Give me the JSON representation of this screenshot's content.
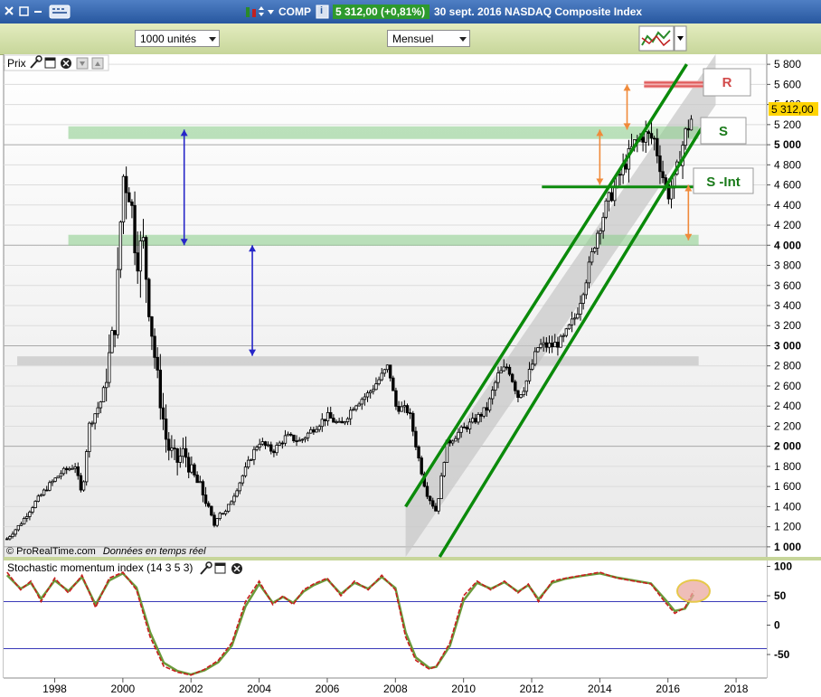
{
  "window": {
    "ticker": "COMP",
    "info_icon": "i",
    "price_badge": "5 312,00 (+0,81%)",
    "caption": "30 sept. 2016 NASDAQ Composite Index"
  },
  "toolbar": {
    "units": "1000 unités",
    "period": "Mensuel"
  },
  "panels": {
    "price": {
      "label": "Prix",
      "last_price": "5 312,00",
      "credit": "© ProRealTime.com",
      "credit_note": "Données en temps réel"
    },
    "stochastic": {
      "label": "Stochastic momentum index (14 3 5 3)"
    }
  },
  "annotations": {
    "resistance": "R",
    "support": "S",
    "support_int": "S -Int"
  },
  "colors": {
    "resistance": "#e05a5a",
    "support_band": "#8fce8f",
    "channel": "#0a8a0a",
    "arrow_blue": "#2626c8",
    "arrow_orange": "#f08a3a",
    "candles": "#000000",
    "smi": "#c81e1e",
    "signal": "#6a9a3a",
    "titlebar": "#3a6ab0"
  },
  "chart_data": [
    {
      "type": "line",
      "x_tick_labels": [
        "1998",
        "2000",
        "2002",
        "2004",
        "2006",
        "2008",
        "2010",
        "2012",
        "2014",
        "2016",
        "2018"
      ],
      "y_tick_labels": [
        "1 000",
        "1 200",
        "1 400",
        "1 600",
        "1 800",
        "2 000",
        "2 200",
        "2 400",
        "2 600",
        "2 800",
        "3 000",
        "3 200",
        "3 400",
        "3 600",
        "3 800",
        "4 000",
        "4 200",
        "4 400",
        "4 600",
        "4 800",
        "5 000",
        "5 200",
        "5 400",
        "5 600",
        "5 800"
      ],
      "bold_ticks": [
        "1 000",
        "2 000",
        "3 000",
        "4 000",
        "5 000"
      ],
      "ylim": [
        900,
        5900
      ],
      "xlim": [
        1996.5,
        2018.9
      ],
      "series": [
        {
          "x": [
            1996.6,
            1997.0,
            1997.4,
            1997.8,
            1998.2,
            1998.6,
            1998.8,
            1999.0,
            1999.4,
            1999.8,
            2000.0,
            2000.2,
            2000.4,
            2000.6,
            2000.8,
            2001.0,
            2001.3,
            2001.6,
            2001.8,
            2002.0,
            2002.4,
            2002.7,
            2002.8,
            2003.0,
            2003.4,
            2003.8,
            2004.0,
            2004.4,
            2004.8,
            2005.2,
            2005.6,
            2006.0,
            2006.4,
            2006.8,
            2007.2,
            2007.6,
            2007.8,
            2008.0,
            2008.4,
            2008.7,
            2008.9,
            2009.2,
            2009.5,
            2009.9,
            2010.3,
            2010.7,
            2011.0,
            2011.3,
            2011.6,
            2011.8,
            2012.2,
            2012.6,
            2012.9,
            2013.3,
            2013.7,
            2013.9,
            2014.2,
            2014.6,
            2015.0,
            2015.3,
            2015.6,
            2015.8,
            2016.0,
            2016.2,
            2016.5,
            2016.75
          ],
          "values": [
            1080,
            1230,
            1430,
            1600,
            1740,
            1810,
            1500,
            2200,
            2480,
            3300,
            4700,
            4570,
            3900,
            4000,
            3300,
            2700,
            2000,
            1850,
            1950,
            1750,
            1500,
            1200,
            1350,
            1330,
            1620,
            1920,
            2050,
            1950,
            2100,
            2050,
            2180,
            2300,
            2200,
            2420,
            2520,
            2700,
            2800,
            2400,
            2350,
            1850,
            1550,
            1350,
            2020,
            2150,
            2250,
            2380,
            2700,
            2800,
            2500,
            2600,
            3000,
            3000,
            3050,
            3300,
            3800,
            4100,
            4400,
            4700,
            5000,
            5100,
            5050,
            4750,
            4500,
            4650,
            5100,
            5312
          ]
        }
      ],
      "resistance_level": 5600,
      "support_levels": [
        5120,
        4050
      ],
      "support_int_level": 4580,
      "gray_band_level": 2850,
      "channel_lower": {
        "x": [
          2009.3,
          2017.05
        ],
        "y": [
          900,
          5200
        ]
      },
      "channel_upper": {
        "x": [
          2008.3,
          2016.55
        ],
        "y": [
          1400,
          5800
        ]
      },
      "blue_arrows": [
        {
          "x": 2001.8,
          "from": 5150,
          "to": 4000
        },
        {
          "x": 2003.8,
          "from": 4000,
          "to": 2900
        }
      ],
      "orange_arrows": [
        {
          "x": 2014.0,
          "from": 4600,
          "to": 5150
        },
        {
          "x": 2014.8,
          "from": 5150,
          "to": 5600
        },
        {
          "x": 2016.6,
          "from": 4600,
          "to": 4050
        }
      ]
    },
    {
      "type": "line",
      "y_tick_labels": [
        "100",
        "50",
        "0",
        "-50"
      ],
      "ylim": [
        -90,
        110
      ],
      "reference_lines": [
        40,
        -40
      ],
      "series": [
        {
          "x": [
            1996.6,
            1997.0,
            1997.3,
            1997.6,
            1998.0,
            1998.4,
            1998.8,
            1999.2,
            1999.6,
            2000.0,
            2000.4,
            2000.8,
            2001.2,
            2001.6,
            2002.0,
            2002.4,
            2002.8,
            2003.2,
            2003.6,
            2004.0,
            2004.4,
            2004.7,
            2005.0,
            2005.3,
            2005.6,
            2006.0,
            2006.4,
            2006.8,
            2007.2,
            2007.6,
            2008.0,
            2008.3,
            2008.6,
            2009.0,
            2009.2,
            2009.6,
            2010.0,
            2010.4,
            2010.8,
            2011.2,
            2011.6,
            2011.9,
            2012.2,
            2012.6,
            2013.0,
            2013.5,
            2014.0,
            2014.5,
            2015.0,
            2015.5,
            2015.9,
            2016.2,
            2016.5,
            2016.75
          ],
          "values": [
            90,
            60,
            75,
            40,
            80,
            55,
            85,
            30,
            80,
            90,
            60,
            -20,
            -70,
            -80,
            -85,
            -75,
            -60,
            -30,
            40,
            75,
            35,
            50,
            35,
            60,
            70,
            80,
            50,
            75,
            60,
            85,
            60,
            -20,
            -60,
            -75,
            -70,
            -30,
            50,
            75,
            60,
            75,
            55,
            70,
            40,
            75,
            80,
            85,
            90,
            80,
            75,
            70,
            40,
            20,
            30,
            58
          ]
        },
        {
          "x": [
            1996.6,
            1997.0,
            1997.3,
            1997.6,
            1998.0,
            1998.4,
            1998.8,
            1999.2,
            1999.6,
            2000.0,
            2000.4,
            2000.8,
            2001.2,
            2001.6,
            2002.0,
            2002.4,
            2002.8,
            2003.2,
            2003.6,
            2004.0,
            2004.4,
            2004.7,
            2005.0,
            2005.3,
            2005.6,
            2006.0,
            2006.4,
            2006.8,
            2007.2,
            2007.6,
            2008.0,
            2008.3,
            2008.6,
            2009.0,
            2009.2,
            2009.6,
            2010.0,
            2010.4,
            2010.8,
            2011.2,
            2011.6,
            2011.9,
            2012.2,
            2012.6,
            2013.0,
            2013.5,
            2014.0,
            2014.5,
            2015.0,
            2015.5,
            2015.9,
            2016.2,
            2016.5,
            2016.75
          ],
          "values": [
            85,
            62,
            72,
            45,
            76,
            58,
            82,
            35,
            76,
            88,
            64,
            -12,
            -64,
            -78,
            -84,
            -77,
            -63,
            -35,
            32,
            70,
            38,
            48,
            38,
            57,
            68,
            78,
            53,
            72,
            62,
            82,
            63,
            -12,
            -55,
            -73,
            -71,
            -35,
            42,
            72,
            62,
            73,
            57,
            68,
            44,
            72,
            79,
            84,
            88,
            81,
            76,
            71,
            45,
            24,
            28,
            52
          ]
        }
      ]
    }
  ]
}
